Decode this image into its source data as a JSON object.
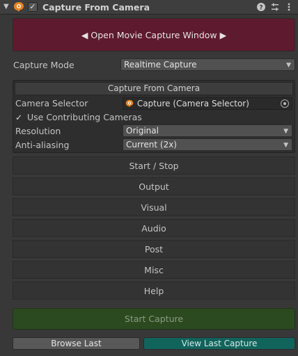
{
  "header": {
    "title": "Capture From Camera",
    "enabled_mark": "✓",
    "icons": [
      "foldout-arrow-icon",
      "recorder-component-icon",
      "help-icon",
      "preset-icon",
      "more-options-icon"
    ]
  },
  "movie_button": {
    "label": "◀ Open Movie Capture Window ▶"
  },
  "capture_mode": {
    "label": "Capture Mode",
    "value": "Realtime Capture"
  },
  "input": {
    "header": "Capture From Camera",
    "camera_selector_label": "Camera Selector",
    "camera_selector_value": "Capture (Camera Selector)",
    "use_contributing_cameras_label": "Use Contributing Cameras",
    "use_contributing_cameras_checked": true,
    "resolution_label": "Resolution",
    "resolution_value": "Original",
    "anti_aliasing_label": "Anti-aliasing",
    "anti_aliasing_value": "Current (2x)"
  },
  "sections": [
    "Start / Stop",
    "Output",
    "Visual",
    "Audio",
    "Post",
    "Misc",
    "Help"
  ],
  "buttons": {
    "start_capture": "Start Capture",
    "browse_last": "Browse Last",
    "view_last_capture": "View Last Capture"
  },
  "colors": {
    "movie_button_bg": "#5e1a2f",
    "start_capture_bg": "#2b4a1f",
    "view_last_bg": "#11645c",
    "icon_orange": "#e8821e"
  }
}
